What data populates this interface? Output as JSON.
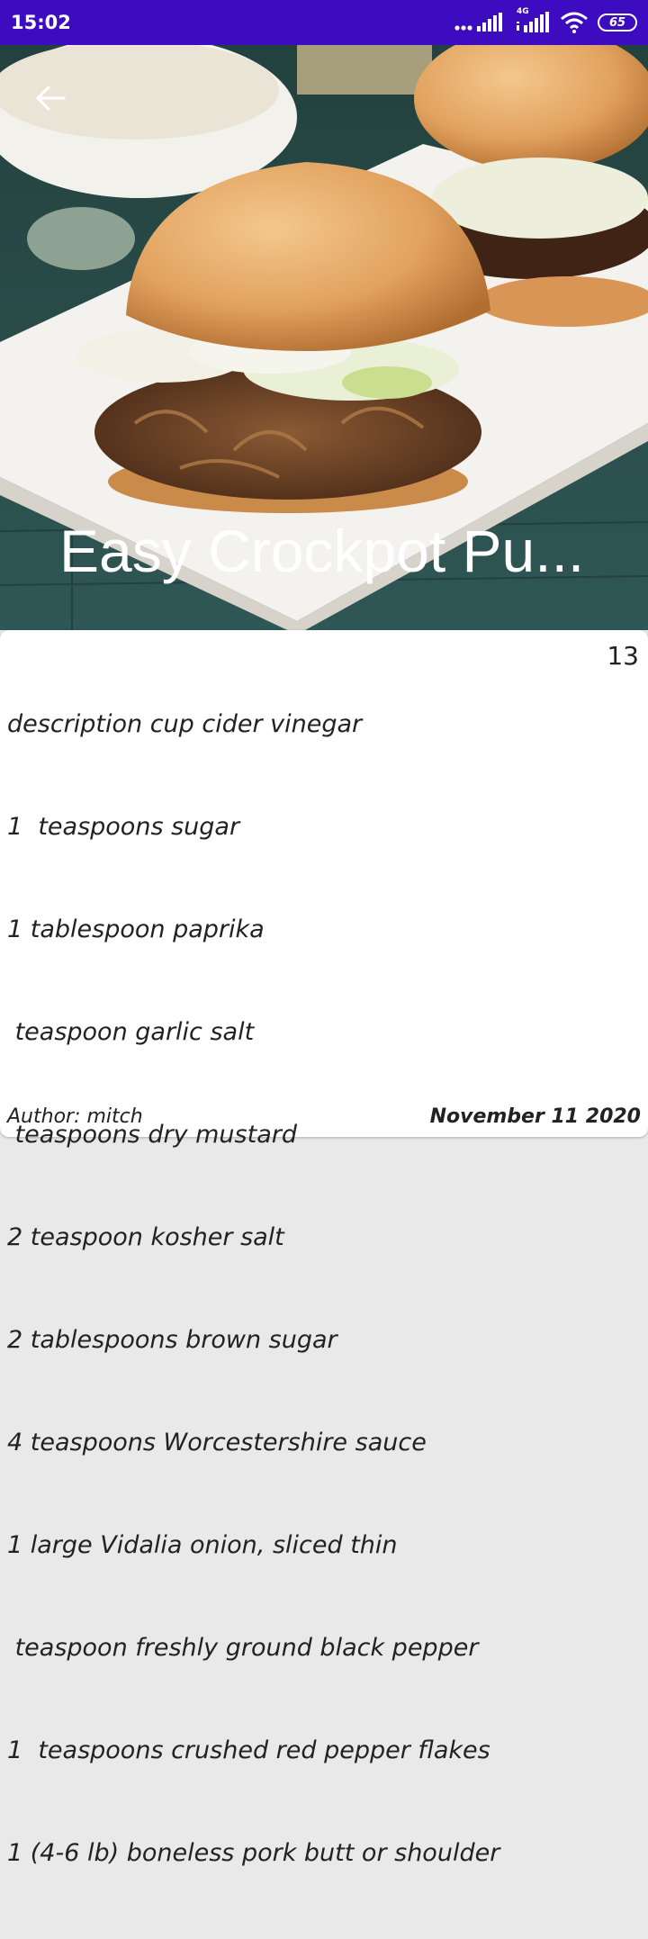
{
  "status_bar": {
    "time": "15:02",
    "network_label": "4G",
    "battery_level": "65",
    "icons": [
      "signal-dots-icon",
      "signal-bars-icon",
      "4g-signal-icon",
      "wifi-icon",
      "battery-icon"
    ],
    "background_color": "#3d0bc0"
  },
  "hero": {
    "image_icon": "pulled-pork-sandwich-photo",
    "back_icon": "back-arrow-icon",
    "title": "Easy Crockpot Pu..."
  },
  "recipe": {
    "count": "13",
    "ingredients": [
      "description cup cider vinegar",
      "1  teaspoons sugar",
      "1 tablespoon paprika",
      " teaspoon garlic salt",
      " teaspoons dry mustard",
      "2 teaspoon kosher salt",
      "2 tablespoons brown sugar",
      "4 teaspoons Worcestershire sauce",
      "1 large Vidalia onion, sliced thin",
      " teaspoon freshly ground black pepper",
      "1  teaspoons crushed red pepper flakes",
      "1 (4-6 lb) boneless pork butt or shoulder"
    ],
    "author": "Author: mitch",
    "date": "November 11 2020"
  }
}
